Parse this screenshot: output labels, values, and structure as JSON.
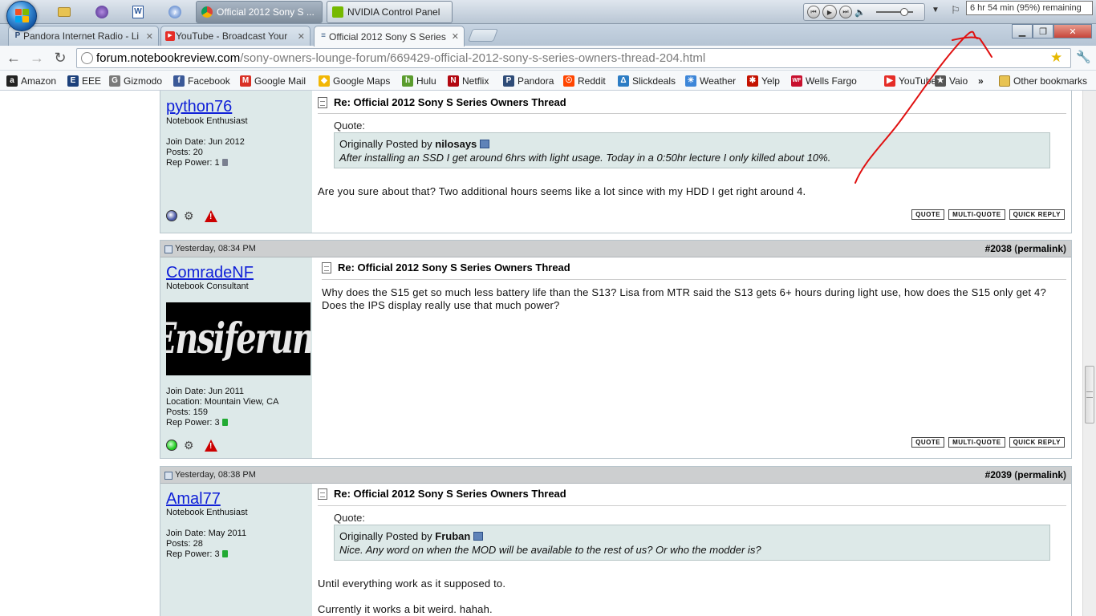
{
  "taskbar": {
    "tasks": [
      {
        "label": "Official 2012 Sony S ...",
        "active": true
      },
      {
        "label": "NVIDIA Control Panel",
        "active": false
      }
    ],
    "battery_tooltip": "6 hr 54 min (95%) remaining"
  },
  "browser": {
    "tabs": [
      {
        "label": "Pandora Internet Radio - Li",
        "icon": "P"
      },
      {
        "label": "YouTube - Broadcast Your",
        "icon": "▶"
      },
      {
        "label": "Official 2012 Sony S Series",
        "icon": "≡"
      }
    ],
    "url_host": "forum.notebookreview.com",
    "url_path": "/sony-owners-lounge-forum/669429-official-2012-sony-s-series-owners-thread-204.html"
  },
  "bookmarks": {
    "items": [
      {
        "label": "Amazon",
        "icon": "a",
        "color": "#222222"
      },
      {
        "label": "EEE",
        "icon": "E",
        "color": "#1b3f7a"
      },
      {
        "label": "Gizmodo",
        "icon": "G",
        "color": "#7a7a7a"
      },
      {
        "label": "Facebook",
        "icon": "f",
        "color": "#3b5998"
      },
      {
        "label": "Google Mail",
        "icon": "M",
        "color": "#d93025"
      },
      {
        "label": "Google Maps",
        "icon": "◆",
        "color": "#f2b705"
      },
      {
        "label": "Hulu",
        "icon": "h",
        "color": "#5b9c2e"
      },
      {
        "label": "Netflix",
        "icon": "N",
        "color": "#b20710"
      },
      {
        "label": "Pandora",
        "icon": "P",
        "color": "#2f4c78"
      },
      {
        "label": "Reddit",
        "icon": "☉",
        "color": "#ff4500"
      },
      {
        "label": "Slickdeals",
        "icon": "Δ",
        "color": "#2c7cc4"
      },
      {
        "label": "Weather",
        "icon": "☀",
        "color": "#3d86d8"
      },
      {
        "label": "Yelp",
        "icon": "✱",
        "color": "#c41200"
      },
      {
        "label": "Wells Fargo",
        "icon": "WF",
        "color": "#c8102e"
      },
      {
        "label": "YouTube",
        "icon": "▶",
        "color": "#e52d27"
      },
      {
        "label": "Vaio",
        "icon": "★",
        "color": "#555555"
      }
    ],
    "more": "»",
    "other": "Other bookmarks"
  },
  "posts": [
    {
      "date": "",
      "number": "",
      "username": "python76",
      "user_title": "Notebook Enthusiast",
      "info": "Join Date: Jun 2012\nPosts: 20\nRep Power: 1",
      "rep_color": "#7a8090",
      "status_color": "#4a5aa8",
      "title": "Re: Official 2012 Sony S Series Owners Thread",
      "quote_label": "Quote:",
      "quote_by": "Originally Posted by",
      "quote_author": "nilosays",
      "quote_text": "After installing an SSD I get around 6hrs with light usage. Today in a 0:50hr lecture I only killed about 10%.",
      "text": "Are you sure about that? Two additional hours seems like a lot since with my HDD I get right around 4.",
      "buttons": [
        "QUOTE",
        "MULTI-QUOTE",
        "QUICK REPLY"
      ]
    },
    {
      "date": "Yesterday, 08:34 PM",
      "number": "#2038",
      "permalink": "permalink",
      "username": "ComradeNF",
      "user_title": "Notebook Consultant",
      "avatar_text": "Ensiferum",
      "info": "Join Date: Jun 2011\nLocation: Mountain View, CA\nPosts: 159\nRep Power: 3",
      "rep_color": "#22aa33",
      "status_color": "#22cc22",
      "title": "Re: Official 2012 Sony S Series Owners Thread",
      "text": "Why does the S15 get so much less battery life than the S13? Lisa from MTR said the S13 gets 6+ hours during light use, how does the S15 only get 4? Does the IPS display really use that much power?",
      "buttons": [
        "QUOTE",
        "MULTI-QUOTE",
        "QUICK REPLY"
      ]
    },
    {
      "date": "Yesterday, 08:38 PM",
      "number": "#2039",
      "permalink": "permalink",
      "username": "Amal77",
      "user_title": "Notebook Enthusiast",
      "info": "Join Date: May 2011\nPosts: 28\nRep Power: 3",
      "rep_color": "#22aa33",
      "title": "Re: Official 2012 Sony S Series Owners Thread",
      "quote_label": "Quote:",
      "quote_by": "Originally Posted by",
      "quote_author": "Fruban",
      "quote_text": "Nice. Any word on when the MOD will be available to the rest of us? Or who the modder is?",
      "text": "Until everything work as it supposed to.",
      "text2": "Currently it works a bit weird. hahah."
    }
  ],
  "colors": {
    "link": "#1020d8",
    "sidebar_bg": "#dde9e9",
    "annotation_red": "#e01010"
  }
}
